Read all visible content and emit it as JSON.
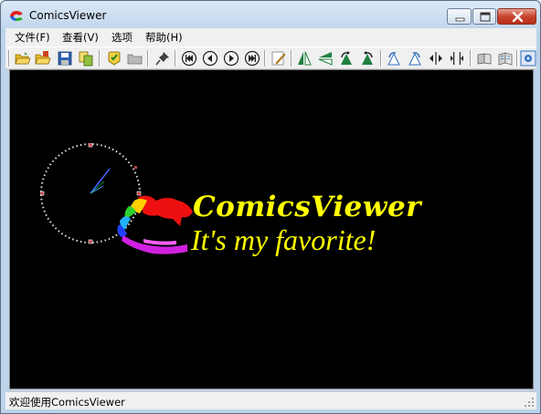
{
  "window": {
    "title": "ComicsViewer"
  },
  "menu": [
    {
      "label": "文件(F)"
    },
    {
      "label": "查看(V)"
    },
    {
      "label": "选项"
    },
    {
      "label": "帮助(H)"
    }
  ],
  "toolbar": {
    "buttons": [
      {
        "icon": "open-folder-icon"
      },
      {
        "icon": "open-archive-folder-icon"
      },
      {
        "icon": "save-icon"
      },
      {
        "icon": "copy-icon"
      },
      {
        "icon": "favorite-icon"
      },
      {
        "icon": "browse-folder-icon"
      },
      {
        "icon": "pin-icon"
      },
      {
        "icon": "first-page-icon"
      },
      {
        "icon": "previous-page-icon"
      },
      {
        "icon": "next-page-icon"
      },
      {
        "icon": "last-page-icon"
      },
      {
        "icon": "edit-icon"
      },
      {
        "icon": "flip-horizontal-icon"
      },
      {
        "icon": "flip-vertical-icon"
      },
      {
        "icon": "rotate-left-icon"
      },
      {
        "icon": "rotate-right-icon"
      },
      {
        "icon": "rotate-left-alt-icon"
      },
      {
        "icon": "rotate-right-alt-icon"
      },
      {
        "icon": "fit-width-icon"
      },
      {
        "icon": "fit-height-icon"
      },
      {
        "icon": "single-page-icon"
      },
      {
        "icon": "double-page-icon"
      },
      {
        "icon": "settings-icon"
      }
    ]
  },
  "viewer": {
    "logo_title": "ComicsViewer",
    "logo_tagline": "It's my favorite!"
  },
  "statusbar": {
    "text": "欢迎使用ComicsViewer"
  },
  "colors": {
    "logo_text": "#ffff00",
    "viewer_bg": "#000000"
  }
}
